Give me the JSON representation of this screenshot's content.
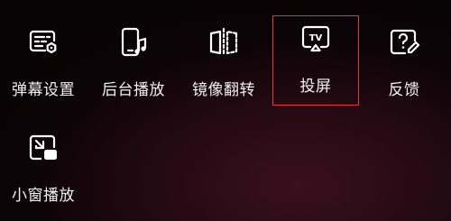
{
  "menu": {
    "items": [
      {
        "id": "danmaku-settings",
        "label": "弹幕设置",
        "icon": "danmaku-settings-icon"
      },
      {
        "id": "background-play",
        "label": "后台播放",
        "icon": "phone-music-icon"
      },
      {
        "id": "mirror-flip",
        "label": "镜像翻转",
        "icon": "mirror-flip-icon"
      },
      {
        "id": "screen-cast",
        "label": "投屏",
        "icon": "tv-cast-icon",
        "highlighted": true
      },
      {
        "id": "feedback",
        "label": "反馈",
        "icon": "feedback-question-icon"
      },
      {
        "id": "mini-window-play",
        "label": "小窗播放",
        "icon": "picture-in-picture-icon"
      }
    ]
  },
  "colors": {
    "highlight_border": "#e23a3a",
    "text": "#f2f2f2",
    "icon_stroke": "#ffffff"
  }
}
